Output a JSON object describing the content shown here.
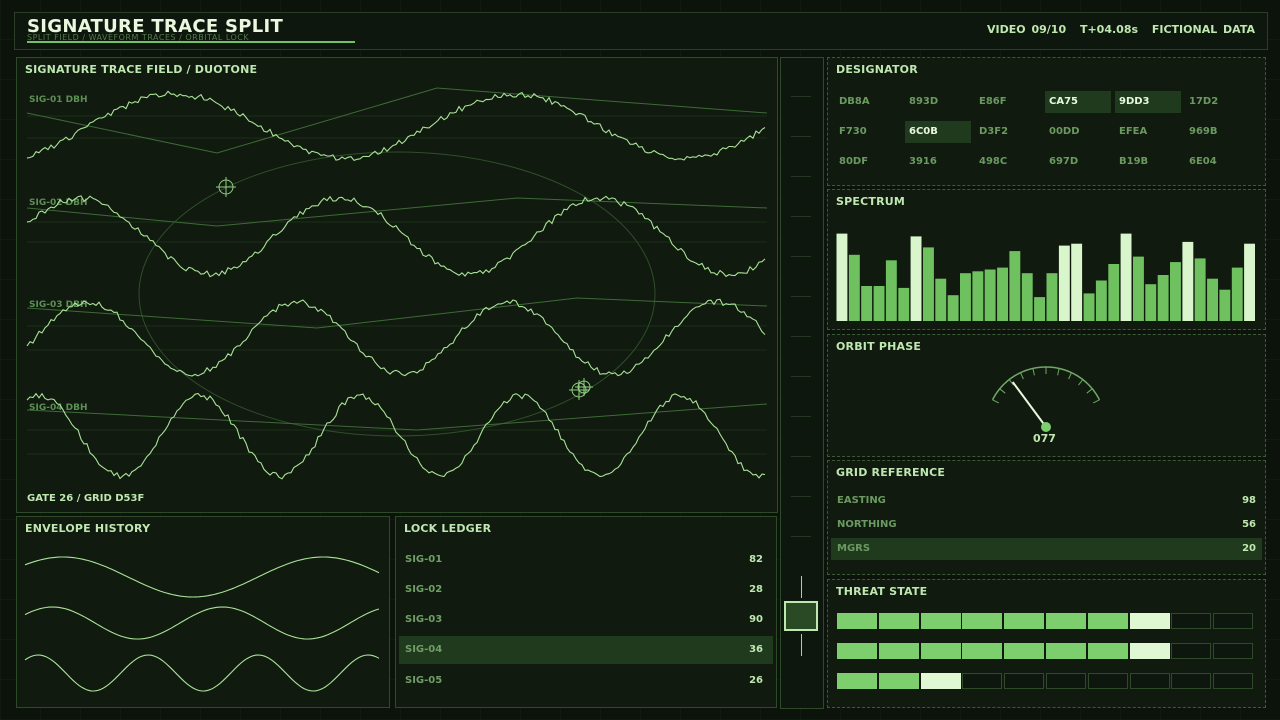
{
  "header": {
    "title": "SIGNATURE TRACE SPLIT",
    "subtitle": "SPLIT FIELD / WAVEFORM TRACES / ORBITAL LOCK",
    "video": "VIDEO 09/10",
    "time": "T+04.08s",
    "note": "FICTIONAL DATA"
  },
  "trace_field": {
    "title": "SIGNATURE TRACE FIELD / DUOTONE",
    "signals": [
      "SIG-01 DBH",
      "SIG-02 DBH",
      "SIG-03 DBH",
      "SIG-04 DBH"
    ],
    "gate": "GATE 26 / GRID D53F"
  },
  "envelope": {
    "title": "ENVELOPE HISTORY"
  },
  "ledger": {
    "title": "LOCK LEDGER",
    "rows": [
      {
        "label": "SIG-01",
        "value": "82"
      },
      {
        "label": "SIG-02",
        "value": "28"
      },
      {
        "label": "SIG-03",
        "value": "90"
      },
      {
        "label": "SIG-04",
        "value": "36"
      },
      {
        "label": "SIG-05",
        "value": "26"
      }
    ],
    "selected": "SIG-04"
  },
  "designator": {
    "title": "DESIGNATOR",
    "codes": [
      "DB8A",
      "893D",
      "E86F",
      "CA75",
      "9DD3",
      "17D2",
      "F730",
      "6C0B",
      "D3F2",
      "00DD",
      "EFEA",
      "969B",
      "80DF",
      "3916",
      "498C",
      "697D",
      "B19B",
      "6E04"
    ],
    "highlighted": [
      "CA75",
      "9DD3",
      "6C0B"
    ]
  },
  "spectrum": {
    "title": "SPECTRUM",
    "bars": [
      0.95,
      0.72,
      0.38,
      0.38,
      0.66,
      0.36,
      0.92,
      0.8,
      0.46,
      0.28,
      0.52,
      0.54,
      0.56,
      0.58,
      0.76,
      0.52,
      0.26,
      0.52,
      0.82,
      0.84,
      0.3,
      0.44,
      0.62,
      0.95,
      0.7,
      0.4,
      0.5,
      0.64,
      0.86,
      0.68,
      0.46,
      0.34,
      0.58,
      0.84
    ],
    "highlight_indices": [
      0,
      6,
      18,
      19,
      23,
      28,
      33
    ],
    "colors": {
      "bar": "#6fc05f",
      "bright": "#d8f5cc"
    }
  },
  "orbit": {
    "title": "ORBIT PHASE",
    "value": "077",
    "fraction": 0.21
  },
  "grid_ref": {
    "title": "GRID REFERENCE",
    "rows": [
      {
        "label": "EASTING",
        "value": "98"
      },
      {
        "label": "NORTHING",
        "value": "56"
      },
      {
        "label": "MGRS",
        "value": "20"
      }
    ],
    "selected": "MGRS"
  },
  "threat": {
    "title": "THREAT STATE",
    "rows": [
      {
        "filled": 7,
        "bright": 1,
        "total": 10
      },
      {
        "filled": 7,
        "bright": 1,
        "total": 10
      },
      {
        "filled": 2,
        "bright": 1,
        "total": 10
      }
    ]
  }
}
